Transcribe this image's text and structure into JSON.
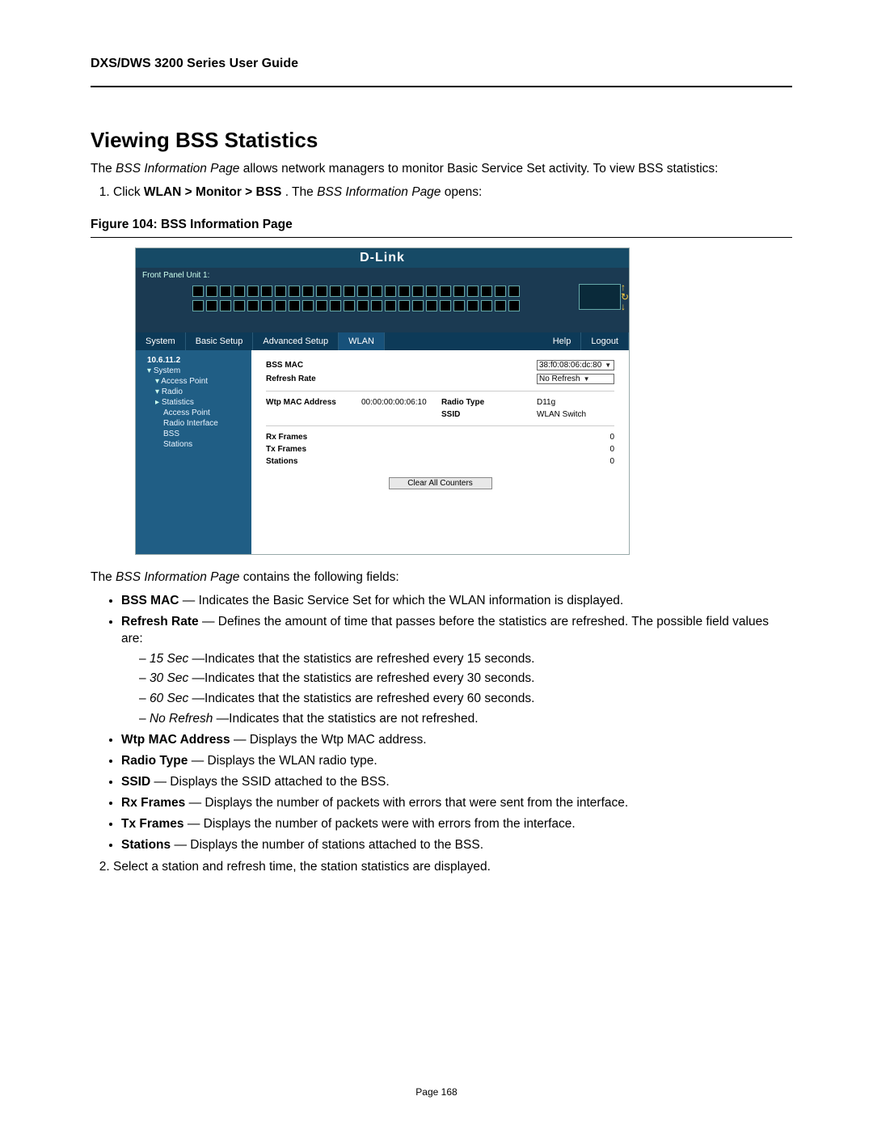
{
  "running_head": "DXS/DWS 3200 Series User Guide",
  "section_title": "Viewing BSS Statistics",
  "intro": {
    "pre": "The ",
    "em": "BSS Information Page",
    "post": " allows network managers to monitor Basic Service Set activity. To view BSS statistics:"
  },
  "step1": {
    "pre": "Click ",
    "bold": "WLAN > Monitor > BSS",
    "mid": ".  The ",
    "em": "BSS Information Page",
    "post": " opens:"
  },
  "figure_caption": "Figure 104: BSS Information Page",
  "fig": {
    "brand": "D-Link",
    "front_panel_label": "Front Panel Unit 1:",
    "tabs": {
      "system": "System",
      "basic": "Basic Setup",
      "advanced": "Advanced Setup",
      "wlan": "WLAN",
      "help": "Help",
      "logout": "Logout"
    },
    "tree": {
      "ip": "10.6.11.2",
      "system": "System",
      "access_point": "Access Point",
      "radio": "Radio",
      "statistics": "Statistics",
      "stat_ap": "Access Point",
      "stat_radio_if": "Radio Interface",
      "stat_bss": "BSS",
      "stat_stations": "Stations"
    },
    "labels": {
      "bss_mac": "BSS MAC",
      "refresh_rate": "Refresh Rate",
      "wtp_mac": "Wtp MAC Address",
      "radio_type": "Radio Type",
      "ssid": "SSID",
      "rx_frames": "Rx Frames",
      "tx_frames": "Tx Frames",
      "stations": "Stations",
      "clear_btn": "Clear All Counters"
    },
    "values": {
      "bss_mac_sel": "38:f0:08:06:dc:80",
      "refresh_sel": "No Refresh",
      "wtp_mac": "00:00:00:00:06:10",
      "radio_type": "D11g",
      "ssid": "WLAN Switch",
      "rx": "0",
      "tx": "0",
      "stations": "0"
    }
  },
  "fields_intro": {
    "pre": "The ",
    "em": "BSS Information Page",
    "post": " contains the following fields:"
  },
  "fields": {
    "bss_mac": {
      "term": "BSS MAC",
      "desc": " — Indicates the Basic Service Set for which the WLAN information is displayed."
    },
    "refresh": {
      "term": "Refresh Rate",
      "desc": " — Defines the amount of time that passes before the statistics are refreshed. The possible field values are:"
    },
    "r15": {
      "em": "15 Sec",
      "desc": "—Indicates that the statistics are refreshed every 15 seconds."
    },
    "r30": {
      "em": "30 Sec",
      "desc": "—Indicates that the statistics are refreshed every 30 seconds."
    },
    "r60": {
      "em": "60 Sec",
      "desc": "—Indicates that the statistics are refreshed every 60 seconds."
    },
    "rno": {
      "em": "No Refresh",
      "desc": "—Indicates that the statistics are not refreshed."
    },
    "wtp": {
      "term": "Wtp MAC Address",
      "desc": " — Displays the Wtp MAC address."
    },
    "radio_type": {
      "term": "Radio Type",
      "desc": " — Displays the WLAN radio type."
    },
    "ssid": {
      "term": "SSID",
      "desc": " — Displays the SSID attached to the BSS."
    },
    "rx": {
      "term": "Rx Frames",
      "desc": " — Displays the number of packets with errors that were sent from the interface."
    },
    "tx": {
      "term": "Tx Frames",
      "desc": " — Displays the number of packets were with errors from the interface."
    },
    "stations": {
      "term": "Stations",
      "desc": " — Displays the number of stations attached to the BSS."
    }
  },
  "step2": "Select a station and refresh time, the station statistics are displayed.",
  "page_num": "Page 168"
}
